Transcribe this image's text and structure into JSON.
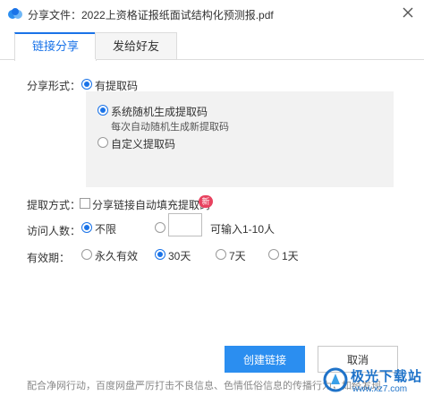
{
  "window": {
    "title": "分享文件：2022上资格证报纸面试结构化预测报.pdf"
  },
  "tabs": [
    {
      "label": "链接分享",
      "active": true
    },
    {
      "label": "发给好友",
      "active": false
    }
  ],
  "share_form": {
    "label": "分享形式：",
    "option_label": "有提取码",
    "option_checked": true,
    "extract_options": [
      {
        "label": "系统随机生成提取码",
        "sub": "每次自动随机生成新提取码",
        "checked": true
      },
      {
        "label": "自定义提取码",
        "checked": false
      }
    ]
  },
  "extract_method": {
    "label": "提取方式：",
    "checkbox_label": "分享链接自动填充提取码",
    "checked": false,
    "badge": "新"
  },
  "visitors": {
    "label": "访问人数：",
    "unlimited_label": "不限",
    "unlimited_checked": true,
    "custom_input_value": "",
    "hint": "可输入1-10人"
  },
  "validity": {
    "label": "有效期：",
    "options": [
      {
        "label": "永久有效",
        "checked": false
      },
      {
        "label": "30天",
        "checked": true
      },
      {
        "label": "7天",
        "checked": false
      },
      {
        "label": "1天",
        "checked": false
      }
    ]
  },
  "buttons": {
    "create": "创建链接",
    "cancel": "取消"
  },
  "footer": {
    "note": "配合净网行动，百度网盘严厉打击不良信息、色情低俗信息的传播行为，如经发现"
  },
  "watermark": {
    "title": "极光下载站",
    "url": "www.xz7.com"
  },
  "colors": {
    "accent": "#1a73e8",
    "primary_button": "#2b8ef0",
    "badge": "#e8425f"
  }
}
